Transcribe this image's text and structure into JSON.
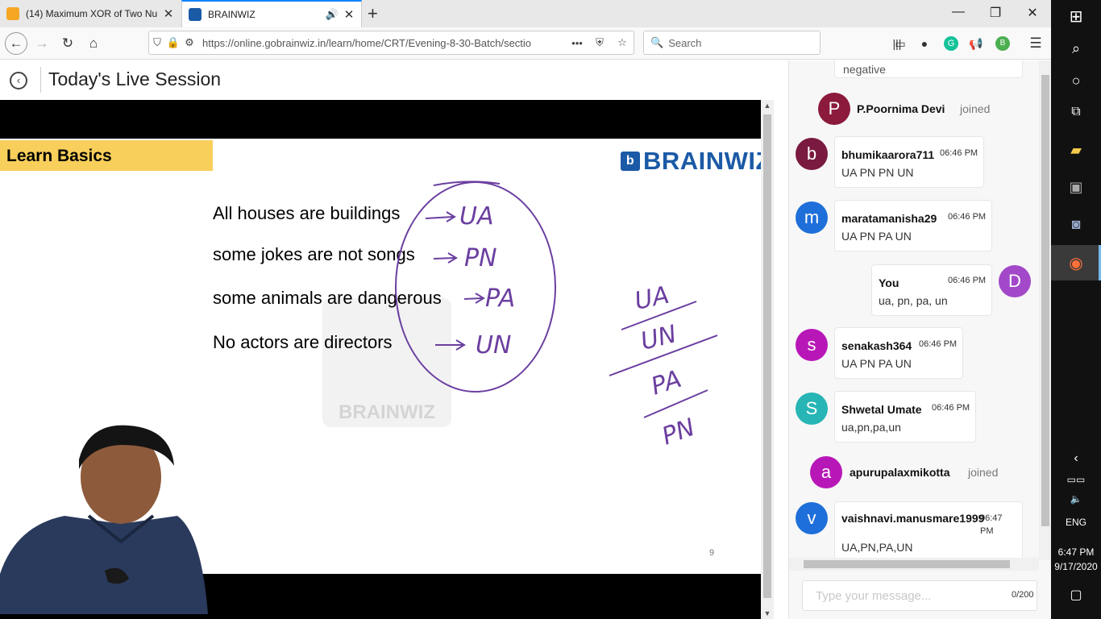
{
  "browser": {
    "tabs": [
      {
        "title": "(14) Maximum XOR of Two Nu",
        "active": false
      },
      {
        "title": "BRAINWIZ",
        "active": true
      }
    ],
    "url": "https://online.gobrainwiz.in/learn/home/CRT/Evening-8-30-Batch/sectio",
    "search_placeholder": "Search",
    "new_tab": "+",
    "more": "•••"
  },
  "page": {
    "title": "Today's Live Session"
  },
  "slide": {
    "badge": "Learn Basics",
    "brand": "BRAINWIZ",
    "statements": [
      "All houses are buildings",
      "some jokes are not songs",
      "some animals are dangerous",
      "No actors are directors"
    ],
    "annotations": [
      "UA",
      "PN",
      "PA",
      "UN"
    ],
    "side_list": [
      "UA",
      "UN",
      "PA",
      "PN"
    ],
    "watermark": "BRAINWIZ",
    "page_number": "9"
  },
  "chat": {
    "top_fragment": "negative",
    "events": [
      {
        "type": "join",
        "initial": "P",
        "name": "P.Poornima Devi",
        "text": "joined",
        "color": "#8b1a3c"
      },
      {
        "type": "msg",
        "initial": "b",
        "name": "bhumikaarora711",
        "time": "06:46 PM",
        "text": "UA PN PN UN",
        "color": "#7a1a40"
      },
      {
        "type": "msg",
        "initial": "m",
        "name": "maratamanisha29",
        "time": "06:46 PM",
        "text": "UA PN PA UN",
        "color": "#1e6fd9"
      },
      {
        "type": "self",
        "initial": "D",
        "name": "You",
        "time": "06:46 PM",
        "text": "ua, pn, pa, un",
        "color": "#a248c9"
      },
      {
        "type": "msg",
        "initial": "s",
        "name": "senakash364",
        "time": "06:46 PM",
        "text": "UA PN PA UN",
        "color": "#b817b8"
      },
      {
        "type": "msg",
        "initial": "S",
        "name": "Shwetal Umate",
        "time": "06:46 PM",
        "text": "ua,pn,pa,un",
        "color": "#27b5b5"
      },
      {
        "type": "join",
        "initial": "a",
        "name": "apurupalaxmikotta",
        "text": "joined",
        "color": "#b817b8"
      },
      {
        "type": "msg",
        "initial": "v",
        "name": "vaishnavi.manusmare1999",
        "time": "06:47 PM",
        "text": "UA,PN,PA,UN",
        "color": "#1e6fd9"
      }
    ],
    "input_placeholder": "Type your message...",
    "char_count": "0/200"
  },
  "taskbar": {
    "language": "ENG",
    "time": "6:47 PM",
    "date": "9/17/2020"
  }
}
